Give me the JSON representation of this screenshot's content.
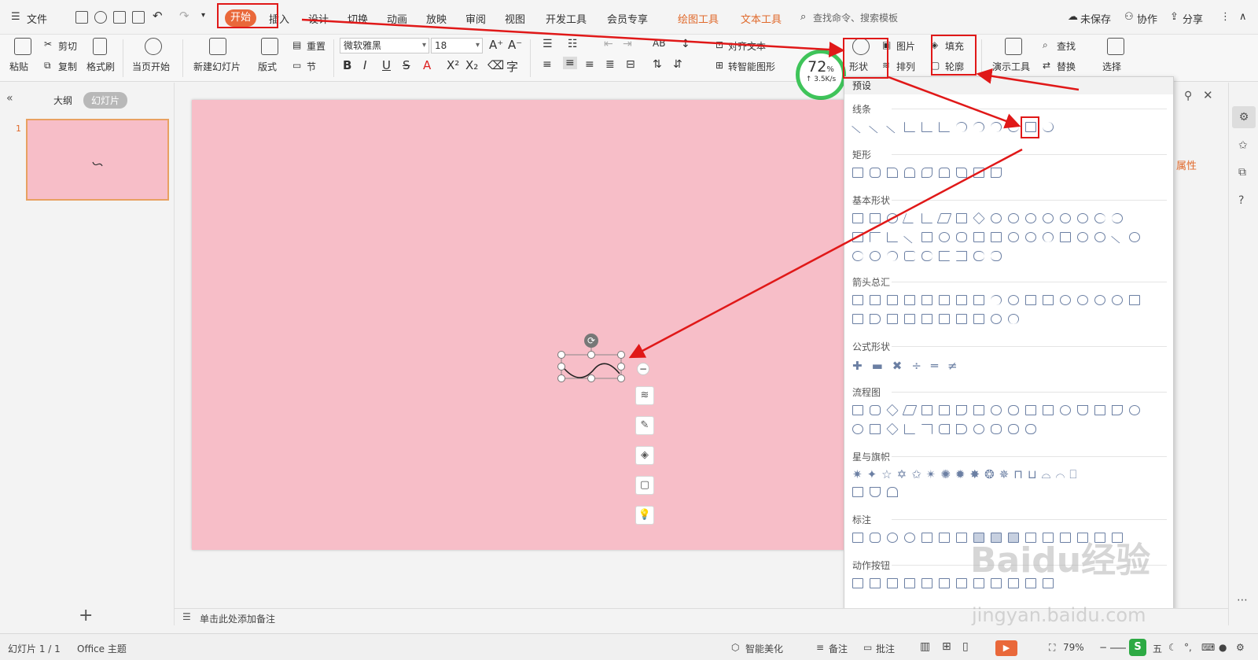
{
  "menubar": {
    "file_label": "文件",
    "tabs": [
      "开始",
      "插入",
      "设计",
      "切换",
      "动画",
      "放映",
      "审阅",
      "视图",
      "开发工具",
      "会员专享"
    ],
    "tool_tabs": [
      "绘图工具",
      "文本工具"
    ],
    "search_placeholder": "查找命令、搜索模板",
    "unsaved": "未保存",
    "collab": "协作",
    "share": "分享"
  },
  "ribbon": {
    "paste": "粘贴",
    "cut": "剪切",
    "copy": "复制",
    "format_painter": "格式刷",
    "from_current": "当页开始",
    "new_slide": "新建幻灯片",
    "layout": "版式",
    "reset": "重置",
    "section": "节",
    "font_name": "微软雅黑",
    "font_size": "18",
    "align_text": "对齐文本",
    "smart_shape": "转智能图形",
    "shape": "形状",
    "picture": "图片",
    "arrange": "排列",
    "fill": "填充",
    "outline": "轮廓",
    "present_tools": "演示工具",
    "find": "查找",
    "replace": "替换",
    "select": "选择"
  },
  "speed_meter": {
    "percent": "72",
    "unit": "%",
    "rate": "3.5K/s"
  },
  "left_panel": {
    "outline_tab": "大纲",
    "slides_tab": "幻灯片",
    "slide_number": "1"
  },
  "shape_dropdown": {
    "header": "预设",
    "categories": [
      "线条",
      "矩形",
      "基本形状",
      "箭头总汇",
      "公式形状",
      "流程图",
      "星与旗帜",
      "标注",
      "动作按钮"
    ]
  },
  "right_panel": {
    "properties_label": "属性"
  },
  "notes": {
    "placeholder": "单击此处添加备注"
  },
  "statusbar": {
    "slide_counter": "幻灯片 1 / 1",
    "theme": "Office 主题",
    "smart_beautify": "智能美化",
    "notes_label": "备注",
    "comments_label": "批注",
    "zoom": "79%"
  },
  "watermark": {
    "brand": "Baidu经验",
    "url": "jingyan.baidu.com"
  },
  "colors": {
    "accent": "#e9683a",
    "slide_bg": "#f7bec8",
    "highlight": "#e01818"
  }
}
